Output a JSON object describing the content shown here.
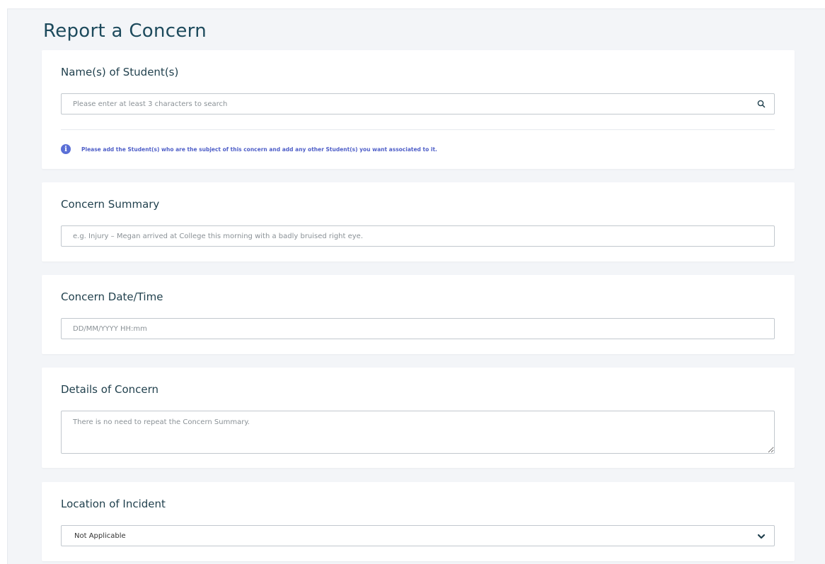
{
  "page": {
    "title": "Report a Concern"
  },
  "students": {
    "label": "Name(s) of Student(s)",
    "search_placeholder": "Please enter at least 3 characters to search",
    "search_value": "",
    "info_text": "Please add the Student(s) who are the subject of this concern and add any other Student(s) you want associated to it."
  },
  "summary": {
    "label": "Concern Summary",
    "placeholder": "e.g. Injury – Megan arrived at College this morning with a badly bruised right eye.",
    "value": ""
  },
  "datetime": {
    "label": "Concern Date/Time",
    "placeholder": "DD/MM/YYYY HH:mm",
    "value": ""
  },
  "details": {
    "label": "Details of Concern",
    "placeholder": "There is no need to repeat the Concern Summary.",
    "value": ""
  },
  "location": {
    "label": "Location of Incident",
    "selected": "Not Applicable"
  },
  "colors": {
    "title": "#1d4a5c",
    "info_accent": "#5a6fd6",
    "background": "#f3f5f8"
  },
  "icons": {
    "search": "search-icon",
    "info": "info-icon",
    "dropdown": "chevron-down-icon"
  }
}
